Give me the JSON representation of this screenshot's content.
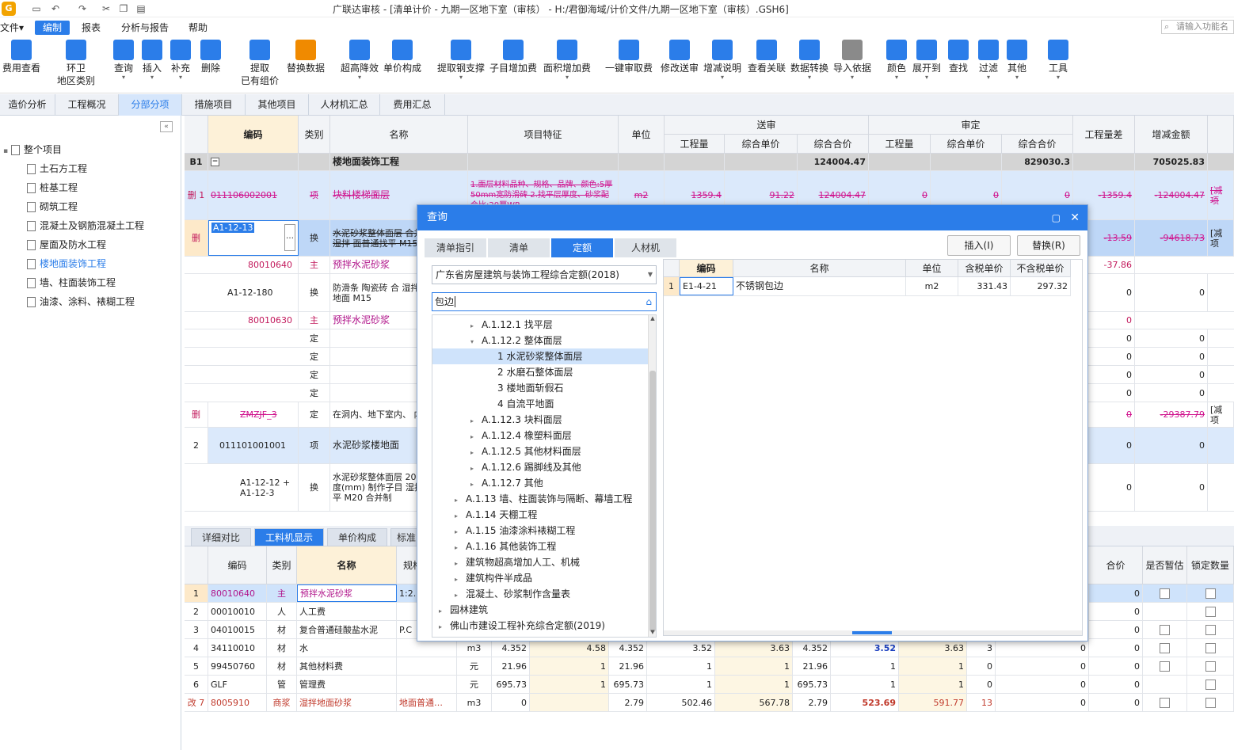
{
  "titlebar": {
    "app_title": "广联达审核 - [清单计价 - 九期一区地下室（审核） - H:/君御海域/计价文件/九期一区地下室（审核）.GSH6]"
  },
  "menu": {
    "file": "文件▾",
    "edit": "编制",
    "report": "报表",
    "analysis": "分析与报告",
    "help": "帮助",
    "search_placeholder": "请输入功能名"
  },
  "ribbon": [
    "费用查看",
    "环卫\n地区类别",
    "查询",
    "插入",
    "补充",
    "删除",
    "提取\n已有组价",
    "替换数据",
    "超高降效",
    "单价构成",
    "提取钢支撑",
    "子目增加费",
    "面积增加费",
    "一键审取费",
    "修改送审",
    "增减说明",
    "查看关联",
    "数据转换",
    "导入依据",
    "颜色",
    "展开到",
    "查找",
    "过滤",
    "其他",
    "工具"
  ],
  "section_tabs": [
    "造价分析",
    "工程概况",
    "分部分项",
    "措施项目",
    "其他项目",
    "人材机汇总",
    "费用汇总"
  ],
  "left_tree": [
    "整个项目",
    "土石方工程",
    "桩基工程",
    "砌筑工程",
    "混凝土及钢筋混凝土工程",
    "屋面及防水工程",
    "楼地面装饰工程",
    "墙、柱面装饰工程",
    "油漆、涂料、裱糊工程"
  ],
  "main_header": {
    "code": "编码",
    "type": "类别",
    "name": "名称",
    "feature": "项目特征",
    "unit": "单位",
    "sent": "送审",
    "approved": "审定",
    "qty": "工程量",
    "unit_price": "综合单价",
    "total": "综合合价",
    "qty_diff": "工程量差",
    "amount_diff": "增减金额"
  },
  "main_rows": [
    {
      "idx": "B1",
      "code": "",
      "type": "",
      "name": "楼地面装饰工程",
      "feature": "",
      "unit": "",
      "s_total": "124004.47",
      "a_total": "829030.3",
      "diff_amt": "705025.83"
    },
    {
      "idx": "删 1",
      "code": "011106002001",
      "type": "项",
      "name": "块料楼梯面层",
      "feature": "1.面层材料品种、规格、品牌、颜色:5厚 50mm宽防滑砖 2.找平层厚度、砂浆配合比:20厚WP",
      "unit": "m2",
      "s_qty": "1359.4",
      "s_price": "91.22",
      "s_total": "124004.47",
      "a_qty": "0",
      "a_price": "0",
      "a_total": "0",
      "diff_qty": "-1359.4",
      "diff_amt": "-124004.47",
      "note": "[减项"
    },
    {
      "idx": "删",
      "code": "A1-12-13",
      "type": "换",
      "name": "水泥砂浆整体面层 合并制作子目 湿拌 面普通找平 M15",
      "diff_qty": "-13.59",
      "diff_amt": "-94618.73",
      "note": "[减项"
    },
    {
      "idx": "",
      "code": "80010640",
      "type": "主",
      "name": "预拌水泥砂浆",
      "diff_qty": "-37.86"
    },
    {
      "idx": "",
      "code": "A1-12-180",
      "type": "换",
      "name": "防滑条 陶瓷砖 合 湿拌地面砂浆 地面 M15",
      "diff_qty": "0",
      "diff_amt": "0"
    },
    {
      "idx": "",
      "code": "80010630",
      "type": "主",
      "name": "预拌水泥砂浆",
      "diff_qty": "0"
    },
    {
      "idx": "",
      "code": "",
      "type": "定",
      "name": "",
      "diff_qty": "0",
      "diff_amt": "0"
    },
    {
      "idx": "",
      "code": "",
      "type": "定",
      "name": "",
      "diff_qty": "0",
      "diff_amt": "0"
    },
    {
      "idx": "",
      "code": "",
      "type": "定",
      "name": "",
      "diff_qty": "0",
      "diff_amt": "0"
    },
    {
      "idx": "",
      "code": "",
      "type": "定",
      "name": "",
      "diff_qty": "0",
      "diff_amt": "0"
    },
    {
      "idx": "删",
      "code": "ZMZJF_3",
      "type": "定",
      "name": "在洞内、地下室内、 内进行施工",
      "diff_qty": "0",
      "diff_amt": "-29387.79",
      "note": "[减项"
    },
    {
      "idx": "2",
      "code": "011101001001",
      "type": "项",
      "name": "水泥砂浆楼地面",
      "diff_qty": "0",
      "diff_amt": "0"
    },
    {
      "idx": "",
      "code": "A1-12-12 + A1-12-3",
      "type": "换",
      "name": "水泥砂浆整体面层 20mm 实际厚度(mm) 制作子目 湿拌地面 通找平 M20 合并制",
      "diff_qty": "0",
      "diff_amt": "0"
    }
  ],
  "bottom_tabs": [
    "详细对比",
    "工料机显示",
    "单价构成",
    "标准"
  ],
  "bottom_header": {
    "code": "编码",
    "type": "类别",
    "name": "名称",
    "spec": "规格",
    "total": "合价",
    "is_temp": "是否暂估",
    "lock_qty": "锁定数量"
  },
  "bottom_rows": [
    {
      "idx": "1",
      "code": "80010640",
      "type": "主",
      "name": "预拌水泥砂浆",
      "spec": "1:2.",
      "unit": "",
      "v1": "",
      "v2": "",
      "v3": "",
      "v4": "",
      "v5": "",
      "v6": "",
      "v7": "",
      "v8": "",
      "v9": "",
      "v10": "",
      "total": "0"
    },
    {
      "idx": "2",
      "code": "00010010",
      "type": "人",
      "name": "人工费",
      "spec": "",
      "unit": "",
      "v1": "",
      "v2": "",
      "v3": "",
      "v4": "",
      "v5": "",
      "v6": "",
      "v7": "",
      "v8": "",
      "v9": "",
      "v10": "",
      "total": "0"
    },
    {
      "idx": "3",
      "code": "04010015",
      "type": "材",
      "name": "复合普通硅酸盐水泥",
      "spec": "P.C",
      "unit": "",
      "v1": "",
      "v2": "",
      "v3": "",
      "v4": "",
      "v5": "",
      "v6": "",
      "v7": "",
      "v8": "",
      "v9": "",
      "v10": "",
      "total": "0"
    },
    {
      "idx": "4",
      "code": "34110010",
      "type": "材",
      "name": "水",
      "spec": "",
      "unit": "m3",
      "v1": "4.352",
      "v2": "4.58",
      "v3": "4.352",
      "v4": "3.52",
      "v5": "3.63",
      "v6": "4.352",
      "v7": "3.52",
      "v8": "3.63",
      "v9": "3",
      "v10": "0",
      "total": "0"
    },
    {
      "idx": "5",
      "code": "99450760",
      "type": "材",
      "name": "其他材料费",
      "spec": "",
      "unit": "元",
      "v1": "21.96",
      "v2": "1",
      "v3": "21.96",
      "v4": "1",
      "v5": "1",
      "v6": "21.96",
      "v7": "1",
      "v8": "1",
      "v9": "0",
      "v10": "0",
      "total": "0"
    },
    {
      "idx": "6",
      "code": "GLF",
      "type": "管",
      "name": "管理费",
      "spec": "",
      "unit": "元",
      "v1": "695.73",
      "v2": "1",
      "v3": "695.73",
      "v4": "1",
      "v5": "1",
      "v6": "695.73",
      "v7": "1",
      "v8": "1",
      "v9": "0",
      "v10": "0",
      "total": "0"
    },
    {
      "idx": "改 7",
      "code": "8005910",
      "type": "商浆",
      "name": "湿拌地面砂浆",
      "spec": "地面普通…",
      "unit": "m3",
      "v1": "0",
      "v2": "",
      "v3": "2.79",
      "v4": "502.46",
      "v5": "567.78",
      "v6": "2.79",
      "v7": "523.69",
      "v8": "591.77",
      "v9": "13",
      "v10": "0",
      "total": "0"
    }
  ],
  "dialog": {
    "title": "查询",
    "tabs": [
      "清单指引",
      "清单",
      "定额",
      "人材机"
    ],
    "insert_btn": "插入(I)",
    "replace_btn": "替换(R)",
    "library": "广东省房屋建筑与装饰工程综合定额(2018)",
    "search_value": "包边",
    "tree": [
      {
        "label": "A.1.12.1 找平层",
        "lvl": 2,
        "tri": "▸"
      },
      {
        "label": "A.1.12.2 整体面层",
        "lvl": 2,
        "tri": "▾"
      },
      {
        "label": "1 水泥砂浆整体面层",
        "lvl": 3,
        "tri": ""
      },
      {
        "label": "2 水磨石整体面层",
        "lvl": 3,
        "tri": ""
      },
      {
        "label": "3 楼地面斩假石",
        "lvl": 3,
        "tri": ""
      },
      {
        "label": "4 自流平地面",
        "lvl": 3,
        "tri": ""
      },
      {
        "label": "A.1.12.3 块料面层",
        "lvl": 2,
        "tri": "▸"
      },
      {
        "label": "A.1.12.4 橡塑料面层",
        "lvl": 2,
        "tri": "▸"
      },
      {
        "label": "A.1.12.5 其他材料面层",
        "lvl": 2,
        "tri": "▸"
      },
      {
        "label": "A.1.12.6 踢脚线及其他",
        "lvl": 2,
        "tri": "▸"
      },
      {
        "label": "A.1.12.7 其他",
        "lvl": 2,
        "tri": "▸"
      },
      {
        "label": "A.1.13 墙、柱面装饰与隔断、幕墙工程",
        "lvl": 1,
        "tri": "▸"
      },
      {
        "label": "A.1.14 天棚工程",
        "lvl": 1,
        "tri": "▸"
      },
      {
        "label": "A.1.15 油漆涂料裱糊工程",
        "lvl": 1,
        "tri": "▸"
      },
      {
        "label": "A.1.16 其他装饰工程",
        "lvl": 1,
        "tri": "▸"
      },
      {
        "label": "建筑物超高增加人工、机械",
        "lvl": 1,
        "tri": "▸"
      },
      {
        "label": "建筑构件半成品",
        "lvl": 1,
        "tri": "▸"
      },
      {
        "label": "混凝土、砂浆制作含量表",
        "lvl": 1,
        "tri": "▸"
      },
      {
        "label": "园林建筑",
        "lvl": 0,
        "tri": "▸"
      },
      {
        "label": "佛山市建设工程补充综合定额(2019)",
        "lvl": 0,
        "tri": "▸"
      }
    ],
    "result_header": {
      "code": "编码",
      "name": "名称",
      "unit": "单位",
      "tax_price": "含税单价",
      "notax_price": "不含税单价"
    },
    "results": [
      {
        "idx": "1",
        "code": "E1-4-21",
        "name": "不锈钢包边",
        "unit": "m2",
        "tax_price": "331.43",
        "notax_price": "297.32"
      }
    ]
  }
}
